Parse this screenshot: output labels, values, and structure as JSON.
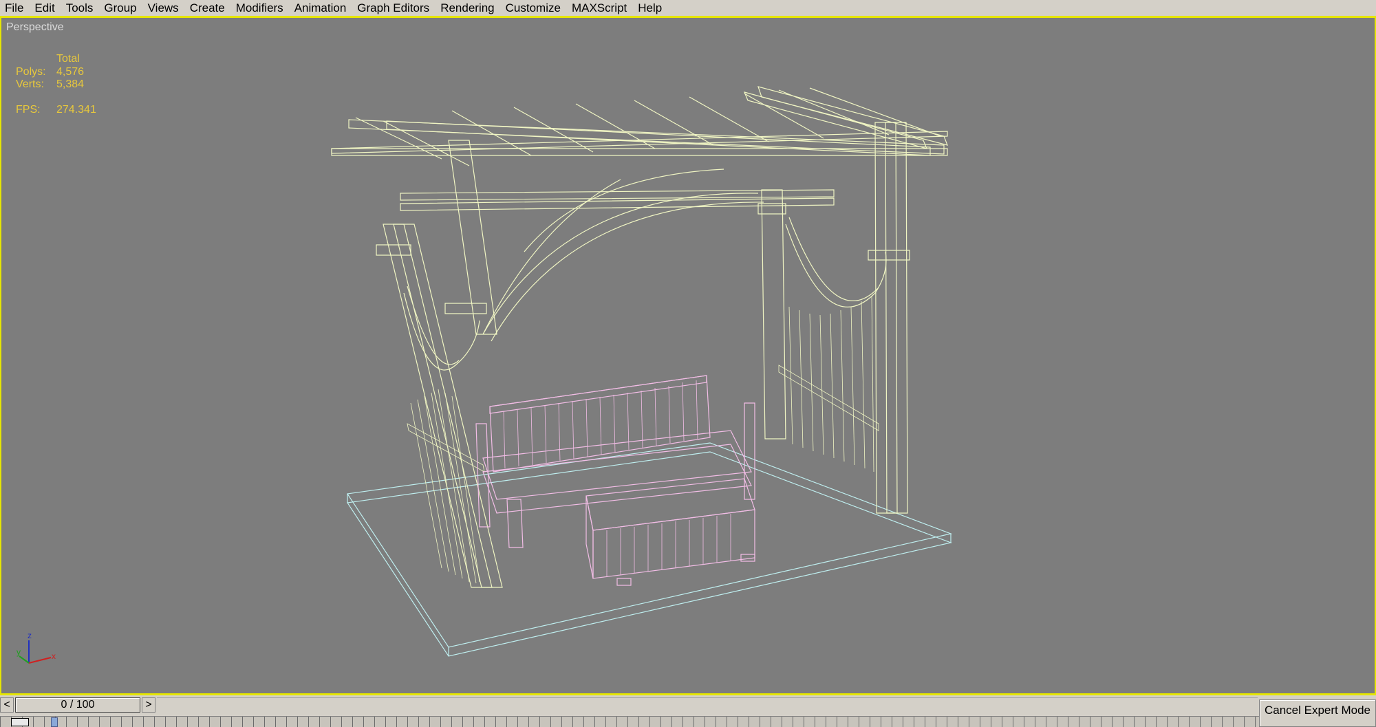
{
  "menu": {
    "items": [
      "File",
      "Edit",
      "Tools",
      "Group",
      "Views",
      "Create",
      "Modifiers",
      "Animation",
      "Graph Editors",
      "Rendering",
      "Customize",
      "MAXScript",
      "Help"
    ]
  },
  "viewport": {
    "label": "Perspective",
    "stats": {
      "total_label": "Total",
      "polys_label": "Polys:",
      "polys_value": "4,576",
      "verts_label": "Verts:",
      "verts_value": "5,384",
      "fps_label": "FPS:",
      "fps_value": "274.341"
    },
    "colors": {
      "background": "#7d7d7d",
      "pergola_wire": "#f0f5c3",
      "furniture_wire": "#f2bde6",
      "ground_wire": "#bfeff0",
      "stats_text": "#e8c83c",
      "active_border": "#e6e600"
    },
    "axis_gizmo": {
      "z": "z",
      "y": "y",
      "x": "x"
    }
  },
  "timeline": {
    "prev_label": "<",
    "slider_label": "0 / 100",
    "next_label": ">",
    "current_frame": 0,
    "total_frames": 100
  },
  "status": {
    "cancel_expert_label": "Cancel Expert Mode"
  }
}
